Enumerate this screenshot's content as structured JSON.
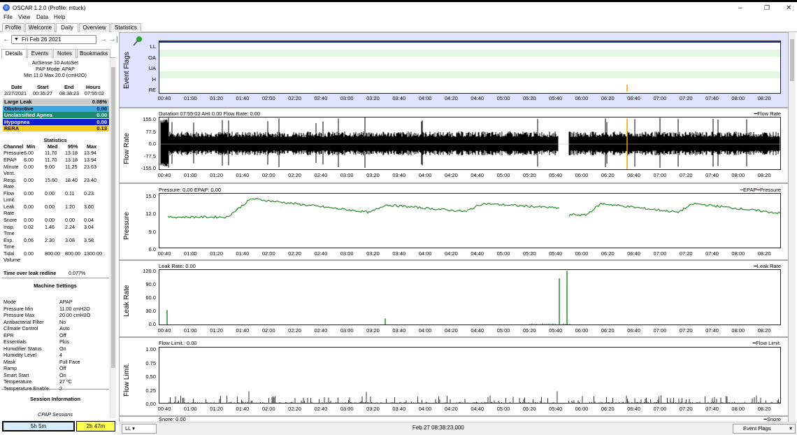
{
  "window": {
    "title": "OSCAR 1.2.0 (Profile: mtuck)"
  },
  "menu": [
    "File",
    "View",
    "Data",
    "Help"
  ],
  "tabs": [
    "Profile",
    "Welcome",
    "Daily",
    "Overview",
    "Statistics"
  ],
  "date": {
    "value": "Fri Feb 26 2021"
  },
  "subtabs": [
    "Details",
    "Events",
    "Notes",
    "Bookmarks"
  ],
  "machine": {
    "name": "AirSense 10 AutoSet",
    "mode": "PAP Mode: APAP",
    "range": "Min 11.0 Max 20.0 (cmH2O)"
  },
  "session_table": {
    "headers": [
      "Date",
      "Start",
      "End",
      "Hours"
    ],
    "values": [
      "2/27/2021",
      "00:35:27",
      "08:38:23",
      "07:55:02"
    ]
  },
  "events": [
    {
      "name": "Large Leak",
      "value": "0.08%",
      "color": "#cccccc",
      "text": "#000000"
    },
    {
      "name": "Obstructive",
      "value": "0.00",
      "color": "#40a8e0",
      "text": "#000000"
    },
    {
      "name": "Unclassified Apnea",
      "value": "0.00",
      "color": "#1a8a70",
      "text": "#ffffff"
    },
    {
      "name": "Hypopnea",
      "value": "0.00",
      "color": "#1020d0",
      "text": "#ffffff"
    },
    {
      "name": "RERA",
      "value": "0.13",
      "color": "#f5d020",
      "text": "#000000"
    }
  ],
  "statistics": {
    "title": "Statistics",
    "headers": [
      "Channel",
      "Min",
      "Med",
      "95%",
      "Max"
    ],
    "rows": [
      {
        "label": [
          "Pressure"
        ],
        "vals": [
          "6.00",
          "11.70",
          "13.18",
          "13.94"
        ]
      },
      {
        "label": [
          "EPAP"
        ],
        "vals": [
          "6.00",
          "11.70",
          "13.18",
          "13.94"
        ]
      },
      {
        "label": [
          "Minute",
          "Vent."
        ],
        "vals": [
          "0.00",
          "9.00",
          "11.25",
          "23.63"
        ]
      },
      {
        "label": [
          "Resp.",
          "Rate"
        ],
        "vals": [
          "0.00",
          "15.60",
          "18.40",
          "23.40"
        ]
      },
      {
        "label": [
          "Flow",
          "Limit."
        ],
        "vals": [
          "0.00",
          "0.00",
          "0.11",
          "0.23"
        ]
      },
      {
        "label": [
          "Leak",
          "Rate"
        ],
        "vals": [
          "0.00",
          "0.00",
          "1.20",
          "3.60"
        ]
      },
      {
        "label": [
          "Snore"
        ],
        "vals": [
          "0.00",
          "0.00",
          "0.00",
          "0.04"
        ]
      },
      {
        "label": [
          "Insp.",
          "Time"
        ],
        "vals": [
          "0.02",
          "1.46",
          "2.24",
          "3.04"
        ]
      },
      {
        "label": [
          "Exp.",
          "Time"
        ],
        "vals": [
          "0.06",
          "2.30",
          "3.08",
          "3.58"
        ]
      },
      {
        "label": [
          "Tidal",
          "Volume"
        ],
        "vals": [
          "0.00",
          "800.00",
          "800.00",
          "1300.00"
        ]
      }
    ]
  },
  "leak_redline": {
    "label": "Time over leak redline",
    "value": "0.077%"
  },
  "machine_settings": {
    "title": "Machine Settings",
    "rows": [
      [
        "Mode",
        "APAP"
      ],
      [
        "Pressure Min",
        "11.00 cmH2O"
      ],
      [
        "Pressure Max",
        "20.00 cmH2O"
      ],
      [
        "Antibacterial Filter",
        "No"
      ],
      [
        "Climate Control",
        "Auto"
      ],
      [
        "EPR",
        "Off"
      ],
      [
        "Essentials",
        "Plus"
      ],
      [
        "Humidifier Status",
        "On"
      ],
      [
        "Humidity Level",
        "4"
      ],
      [
        "Mask",
        "Full Face"
      ],
      [
        "Ramp",
        "Off"
      ],
      [
        "Smart Start",
        "On"
      ],
      [
        "Temperature",
        "27 ºC"
      ],
      [
        "Temperature Enable",
        "2"
      ]
    ]
  },
  "session_info": {
    "title": "Session Information",
    "sub": "CPAP Sessions"
  },
  "bottom": {
    "total": "5h 5m",
    "other": "2h 47m"
  },
  "x_ticks": [
    "00:40",
    "01:00",
    "01:20",
    "01:40",
    "02:00",
    "02:20",
    "02:40",
    "03:00",
    "03:20",
    "03:40",
    "04:00",
    "04:20",
    "04:40",
    "05:00",
    "05:20",
    "05:40",
    "06:00",
    "06:20",
    "06:40",
    "07:00",
    "07:20",
    "07:40",
    "08:00",
    "08:20"
  ],
  "graphs": {
    "event_flags": {
      "title": "Event Flags",
      "labels": [
        "LL",
        "OA",
        "UA",
        "H",
        "RE"
      ]
    },
    "flow_rate": {
      "title": "Flow Rate",
      "caption": "Duration 07:55:02 AHI 0.00 Flow Rate: 0.00",
      "legend": "Flow Rate",
      "yticks": [
        "155.0",
        "77.5",
        "0.0",
        "-77.5",
        "-155.0"
      ]
    },
    "pressure": {
      "title": "Pressure",
      "caption": "Pressure: 0.00 EPAP: 0.00",
      "legend_epap": "EPAP",
      "legend_pressure": "Pressure",
      "yticks": [
        "15.0",
        "12.0",
        "9.0",
        "6.0"
      ],
      "color": "#2a8a2a"
    },
    "leak_rate": {
      "title": "Leak Rate",
      "caption": "Leak Rate: 0.00",
      "legend": "Leak Rate",
      "yticks": [
        "120.0",
        "90.0",
        "60.0",
        "30.0",
        "0.0"
      ]
    },
    "flow_limit": {
      "title": "Flow Limit.",
      "caption": "Flow Limit.: 0.00",
      "legend": "Flow Limit.",
      "yticks": [
        "1.00",
        "0.75",
        "0.50",
        "0.25",
        "0.00"
      ]
    },
    "snore": {
      "caption": "Snore: 0.00",
      "legend": "Snore"
    }
  },
  "status": {
    "ll": "LL",
    "datetime": "Feb 27 08:38:23.000",
    "flags": "Event Flags"
  }
}
